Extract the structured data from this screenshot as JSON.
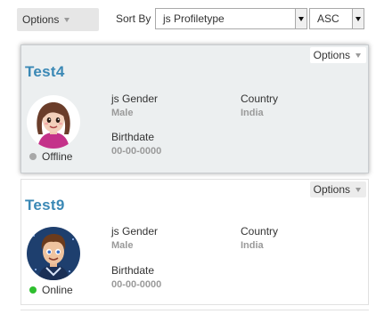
{
  "toolbar": {
    "options_label": "Options",
    "sort_by_label": "Sort By",
    "sort_field": "js Profiletype",
    "sort_order": "ASC"
  },
  "members": [
    {
      "name": "Test4",
      "options_label": "Options",
      "gender_label": "js Gender",
      "gender_value": "Male",
      "country_label": "Country",
      "country_value": "India",
      "birthdate_label": "Birthdate",
      "birthdate_value": "00-00-0000",
      "status": "Offline",
      "status_color": "#a8a8a8",
      "avatar": "female-avatar"
    },
    {
      "name": "Test9",
      "options_label": "Options",
      "gender_label": "js Gender",
      "gender_value": "Male",
      "country_label": "Country",
      "country_value": "India",
      "birthdate_label": "Birthdate",
      "birthdate_value": "00-00-0000",
      "status": "Online",
      "status_color": "#2fbf2f",
      "avatar": "male-avatar"
    }
  ],
  "colors": {
    "accent": "#3a88b5",
    "highlight_bg": "#eceff0",
    "value_gray": "#9a9a9a"
  }
}
